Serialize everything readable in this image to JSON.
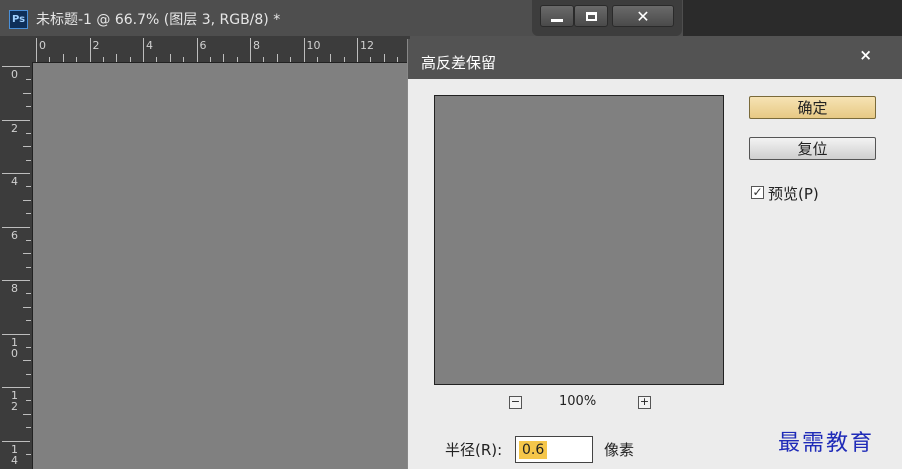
{
  "window": {
    "app_icon_text": "Ps",
    "title": "未标题-1 @ 66.7% (图层 3, RGB/8) *",
    "close_symbol": "✕"
  },
  "rulers": {
    "horizontal_labels": [
      "0",
      "2",
      "4",
      "6",
      "8",
      "10",
      "12"
    ],
    "vertical_labels": [
      "0",
      "2",
      "4",
      "6",
      "8",
      "1\n0",
      "1\n2",
      "1\n4"
    ]
  },
  "dialog": {
    "title": "高反差保留",
    "close_symbol": "×",
    "ok_label": "确定",
    "reset_label": "复位",
    "preview_checked": true,
    "preview_label": "预览(P)",
    "zoom_out_symbol": "−",
    "zoom_in_symbol": "+",
    "zoom_level": "100%",
    "radius_label": "半径(R):",
    "radius_value": "0.6",
    "radius_unit": "像素"
  },
  "watermark": "最需教育",
  "colors": {
    "ok_button": "#e7c984",
    "canvas_gray": "#808080",
    "watermark": "#1f2bb8"
  }
}
